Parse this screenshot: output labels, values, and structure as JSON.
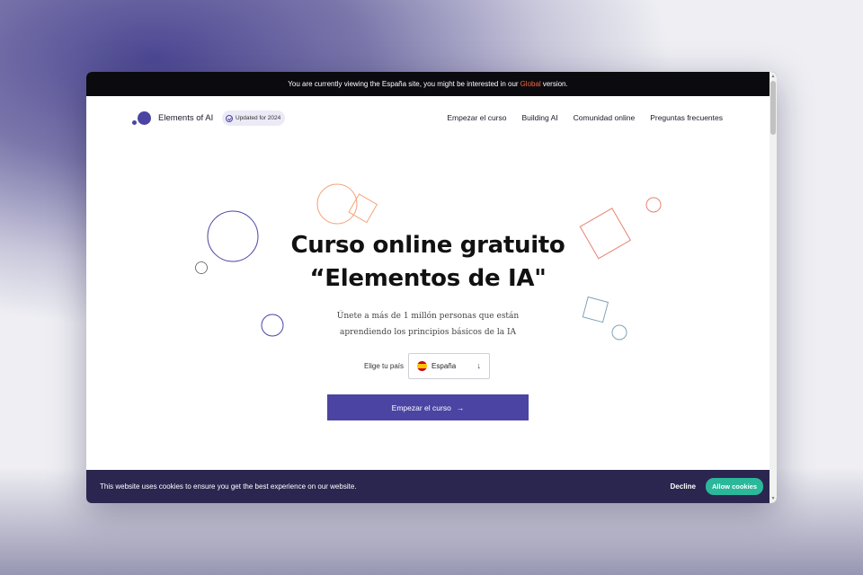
{
  "banner": {
    "text_before": "You are currently viewing the España site, you might be interested in our",
    "link": "Global",
    "text_after": "version."
  },
  "header": {
    "brand": "Elements of AI",
    "badge": "Updated for 2024",
    "nav": [
      "Empezar el curso",
      "Building AI",
      "Comunidad online",
      "Preguntas frecuentes"
    ]
  },
  "hero": {
    "title_line1": "Curso online gratuito",
    "title_line2": "“Elementos de IA\"",
    "subtitle_line1": "Únete a más de 1 millón personas que están",
    "subtitle_line2": "aprendiendo los principios básicos de la IA"
  },
  "country": {
    "label": "Elige tu país",
    "selected": "España",
    "arrow": "↓"
  },
  "cta": {
    "label": "Empezar el curso",
    "arrow": "→"
  },
  "cookies": {
    "text": "This website uses cookies to ensure you get the best experience on our website.",
    "decline": "Decline",
    "allow": "Allow cookies"
  },
  "colors": {
    "brand": "#4b44a3",
    "banner_link": "#f4623a",
    "cookie_bg": "#2b2650",
    "allow": "#2bb89a"
  }
}
